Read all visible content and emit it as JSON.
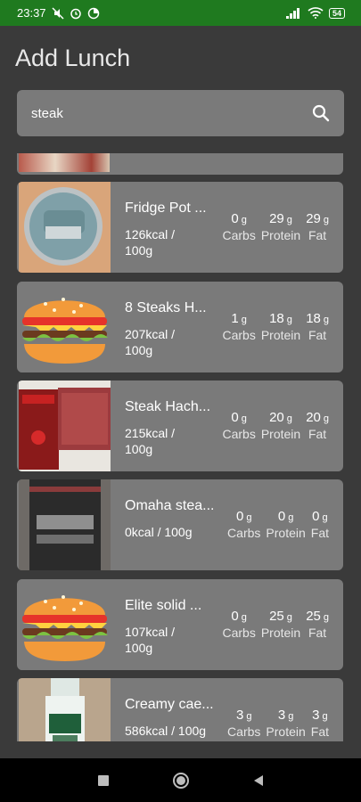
{
  "status": {
    "time": "23:37",
    "battery": "54"
  },
  "title": "Add Lunch",
  "search": {
    "value": "steak"
  },
  "items": [
    {
      "name": "Fridge Pot ...",
      "kcal": "126kcal / 100g",
      "carbs": "0",
      "protein": "29",
      "fat": "29",
      "image": "fridge-pot-product"
    },
    {
      "name": "8 Steaks H...",
      "kcal": "207kcal / 100g",
      "carbs": "1",
      "protein": "18",
      "fat": "18",
      "image": "burger-placeholder"
    },
    {
      "name": "Steak Hach...",
      "kcal": "215kcal / 100g",
      "carbs": "0",
      "protein": "20",
      "fat": "20",
      "image": "charal-minced-steak"
    },
    {
      "name": "Omaha stea...",
      "kcal": "0kcal / 100g",
      "carbs": "0",
      "protein": "0",
      "fat": "0",
      "image": "private-reserve-bottle"
    },
    {
      "name": "Elite solid ...",
      "kcal": "107kcal / 100g",
      "carbs": "0",
      "protein": "25",
      "fat": "25",
      "image": "burger-placeholder"
    },
    {
      "name": "Creamy cae...",
      "kcal": "586kcal / 100g",
      "carbs": "3",
      "protein": "3",
      "fat": "3",
      "image": "dressing-bottle"
    }
  ],
  "labels": {
    "unit": "g",
    "carbs": "Carbs",
    "protein": "Protein",
    "fat": "Fat"
  }
}
